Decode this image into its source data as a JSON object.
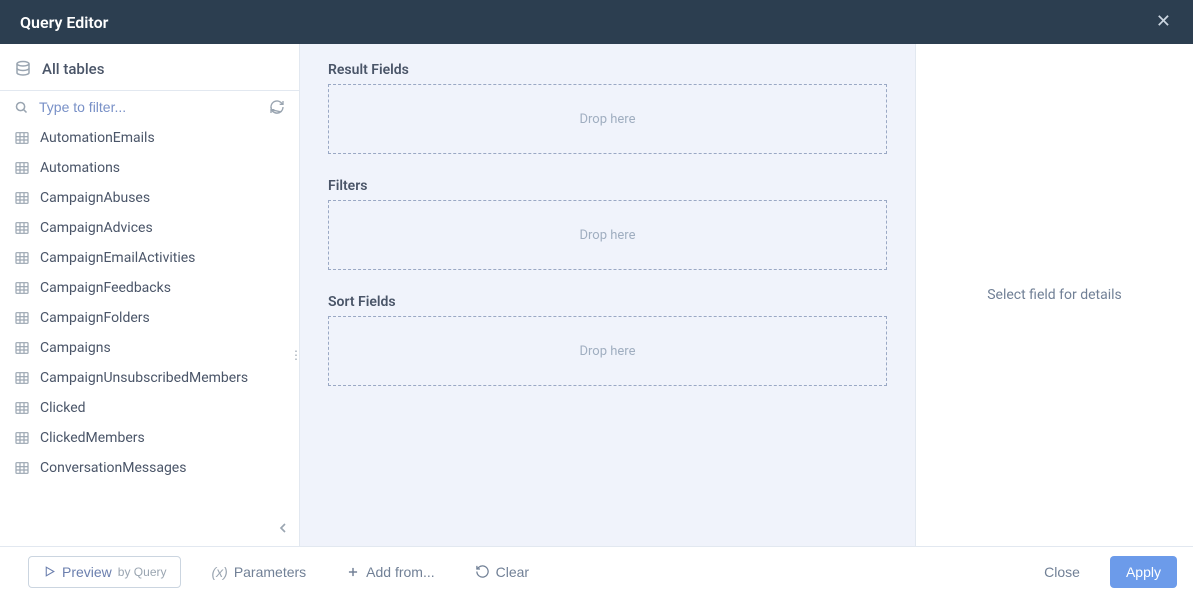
{
  "header": {
    "title": "Query Editor"
  },
  "sidebar": {
    "title": "All tables",
    "filter_placeholder": "Type to filter...",
    "tables": [
      "AutomationEmails",
      "Automations",
      "CampaignAbuses",
      "CampaignAdvices",
      "CampaignEmailActivities",
      "CampaignFeedbacks",
      "CampaignFolders",
      "Campaigns",
      "CampaignUnsubscribedMembers",
      "Clicked",
      "ClickedMembers",
      "ConversationMessages"
    ]
  },
  "center": {
    "sections": {
      "result_fields": {
        "label": "Result Fields",
        "placeholder": "Drop here"
      },
      "filters": {
        "label": "Filters",
        "placeholder": "Drop here"
      },
      "sort_fields": {
        "label": "Sort Fields",
        "placeholder": "Drop here"
      }
    }
  },
  "right_panel": {
    "placeholder": "Select field for details"
  },
  "footer": {
    "preview": {
      "label": "Preview",
      "sub": "by Query"
    },
    "parameters_label": "Parameters",
    "add_from_label": "Add from...",
    "clear_label": "Clear",
    "close_label": "Close",
    "apply_label": "Apply"
  }
}
